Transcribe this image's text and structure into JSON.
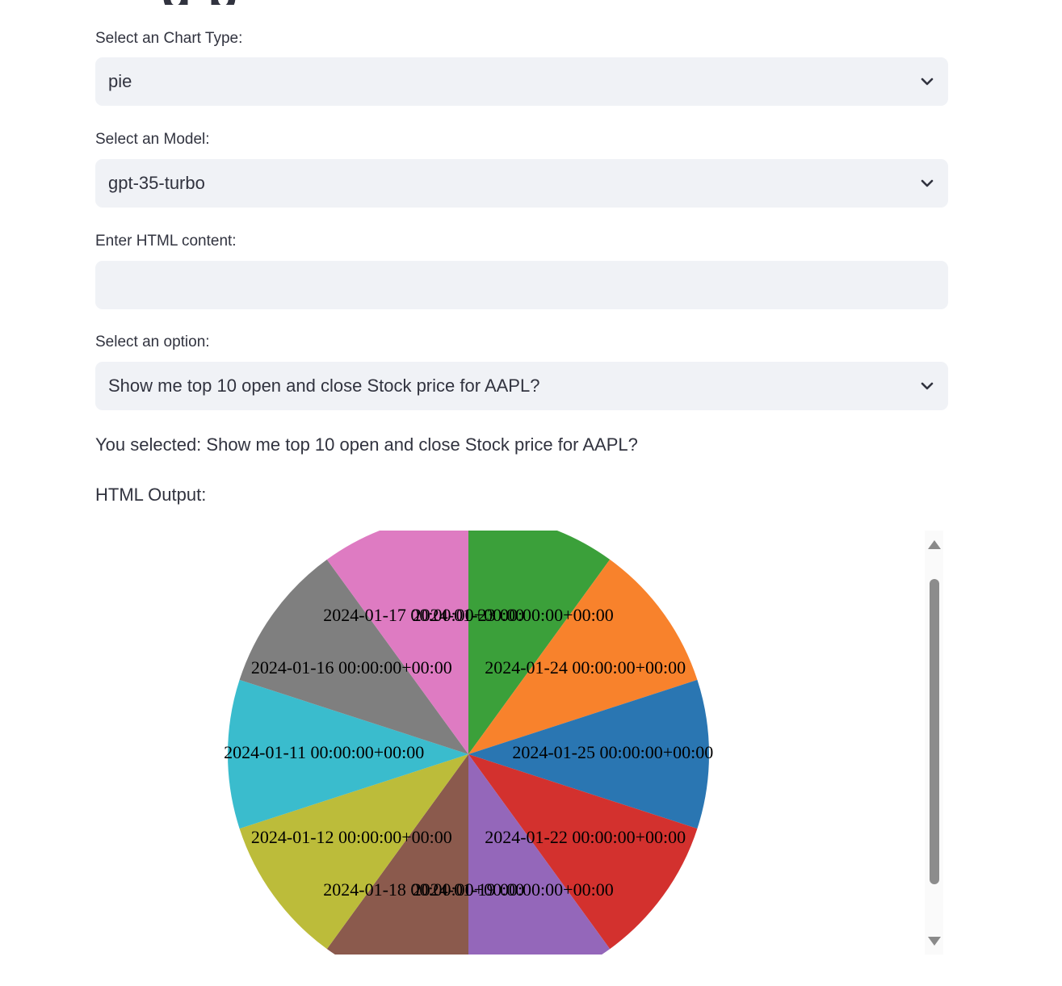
{
  "form": {
    "chart_type": {
      "label": "Select an Chart Type:",
      "value": "pie"
    },
    "model": {
      "label": "Select an Model:",
      "value": "gpt-35-turbo"
    },
    "html_content": {
      "label": "Enter HTML content:",
      "value": "",
      "placeholder": ""
    },
    "option": {
      "label": "Select an option:",
      "value": "Show me top 10 open and close Stock price for AAPL?"
    }
  },
  "selection_text": "You selected: Show me top 10 open and close Stock price for AAPL?",
  "output_label": "HTML Output:",
  "icons": {
    "dropdown": "chevron-down-icon",
    "scroll_up": "triangle-up-icon",
    "scroll_down": "triangle-down-icon"
  },
  "chart_data": {
    "type": "pie",
    "slices": [
      {
        "label": "2024-01-23 00:00:00+00:00",
        "value": 10,
        "color": "#3ba03a"
      },
      {
        "label": "2024-01-24 00:00:00+00:00",
        "value": 10,
        "color": "#f8822c"
      },
      {
        "label": "2024-01-25 00:00:00+00:00",
        "value": 10,
        "color": "#2a76b2"
      },
      {
        "label": "2024-01-22 00:00:00+00:00",
        "value": 10,
        "color": "#d3312e"
      },
      {
        "label": "2024-01-19 00:00:00+00:00",
        "value": 10,
        "color": "#9467ba"
      },
      {
        "label": "2024-01-18 00:00:00+00:00",
        "value": 10,
        "color": "#8b5a4d"
      },
      {
        "label": "2024-01-12 00:00:00+00:00",
        "value": 10,
        "color": "#bcbc3a"
      },
      {
        "label": "2024-01-11 00:00:00+00:00",
        "value": 10,
        "color": "#3abccd"
      },
      {
        "label": "2024-01-16 00:00:00+00:00",
        "value": 10,
        "color": "#7f7f7f"
      },
      {
        "label": "2024-01-17 00:00:00+00:00",
        "value": 10,
        "color": "#de7bc2"
      }
    ]
  }
}
